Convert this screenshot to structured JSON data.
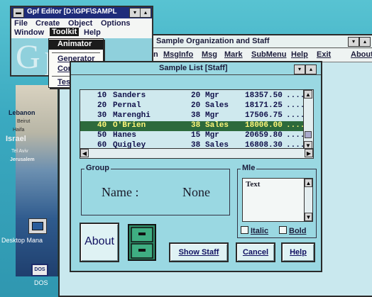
{
  "desktop": {
    "map_labels": [
      "Lebanon",
      "Beirut",
      "Haifa",
      "Israel",
      "Tel Aviv",
      "Jerusalem"
    ],
    "icons": [
      {
        "label": "Desktop Mana",
        "icon": "desktop-manager-icon"
      },
      {
        "label": "DOS",
        "icon": "dos-icon"
      }
    ]
  },
  "editor": {
    "title": "Gpf Editor [D:\\GPF\\SAMPL",
    "menu": [
      "File",
      "Create",
      "Object",
      "Options",
      "Window",
      "Toolkit",
      "Help"
    ],
    "logo": "Gpf",
    "dropdown": {
      "items": [
        "Animator",
        "Generator",
        "Compiler",
        "Test"
      ],
      "selected": "Animator"
    }
  },
  "backwindow": {
    "title": "Sample Organization and Staff",
    "menu": [
      "n",
      "MsgInfo",
      "Msg",
      "Mark",
      "SubMenu",
      "Help",
      "Exit",
      "About"
    ]
  },
  "dialog": {
    "title": "Sample List [Staff]",
    "list": {
      "rows": [
        {
          "id": "10",
          "name": "Sanders",
          "dept": "20",
          "job": "Mgr",
          "salary": "18357.50",
          "more": "....."
        },
        {
          "id": "20",
          "name": "Pernal",
          "dept": "20",
          "job": "Sales",
          "salary": "18171.25",
          "more": "....."
        },
        {
          "id": "30",
          "name": "Marenghi",
          "dept": "38",
          "job": "Mgr",
          "salary": "17506.75",
          "more": "....."
        },
        {
          "id": "40",
          "name": "O'Brien",
          "dept": "38",
          "job": "Sales",
          "salary": "18006.00",
          "more": "....."
        },
        {
          "id": "50",
          "name": "Hanes",
          "dept": "15",
          "job": "Mgr",
          "salary": "20659.80",
          "more": "....."
        },
        {
          "id": "60",
          "name": "Quigley",
          "dept": "38",
          "job": "Sales",
          "salary": "16808.30",
          "more": "....."
        }
      ],
      "selected_index": 3
    },
    "group": {
      "label": "Group",
      "name_label": "Name :",
      "name_value": "None"
    },
    "mle": {
      "label": "Mle",
      "text": "Text",
      "italic_label": "Italic",
      "bold_label": "Bold"
    },
    "buttons": {
      "about": "About",
      "show_staff": "Show Staff",
      "cancel": "Cancel",
      "help": "Help"
    }
  },
  "colors": {
    "desktop": "#3fb0c4",
    "selection_bg": "#2d6a3c",
    "selection_fg": "#fff67a",
    "title_bar": "#1e2c7a"
  }
}
